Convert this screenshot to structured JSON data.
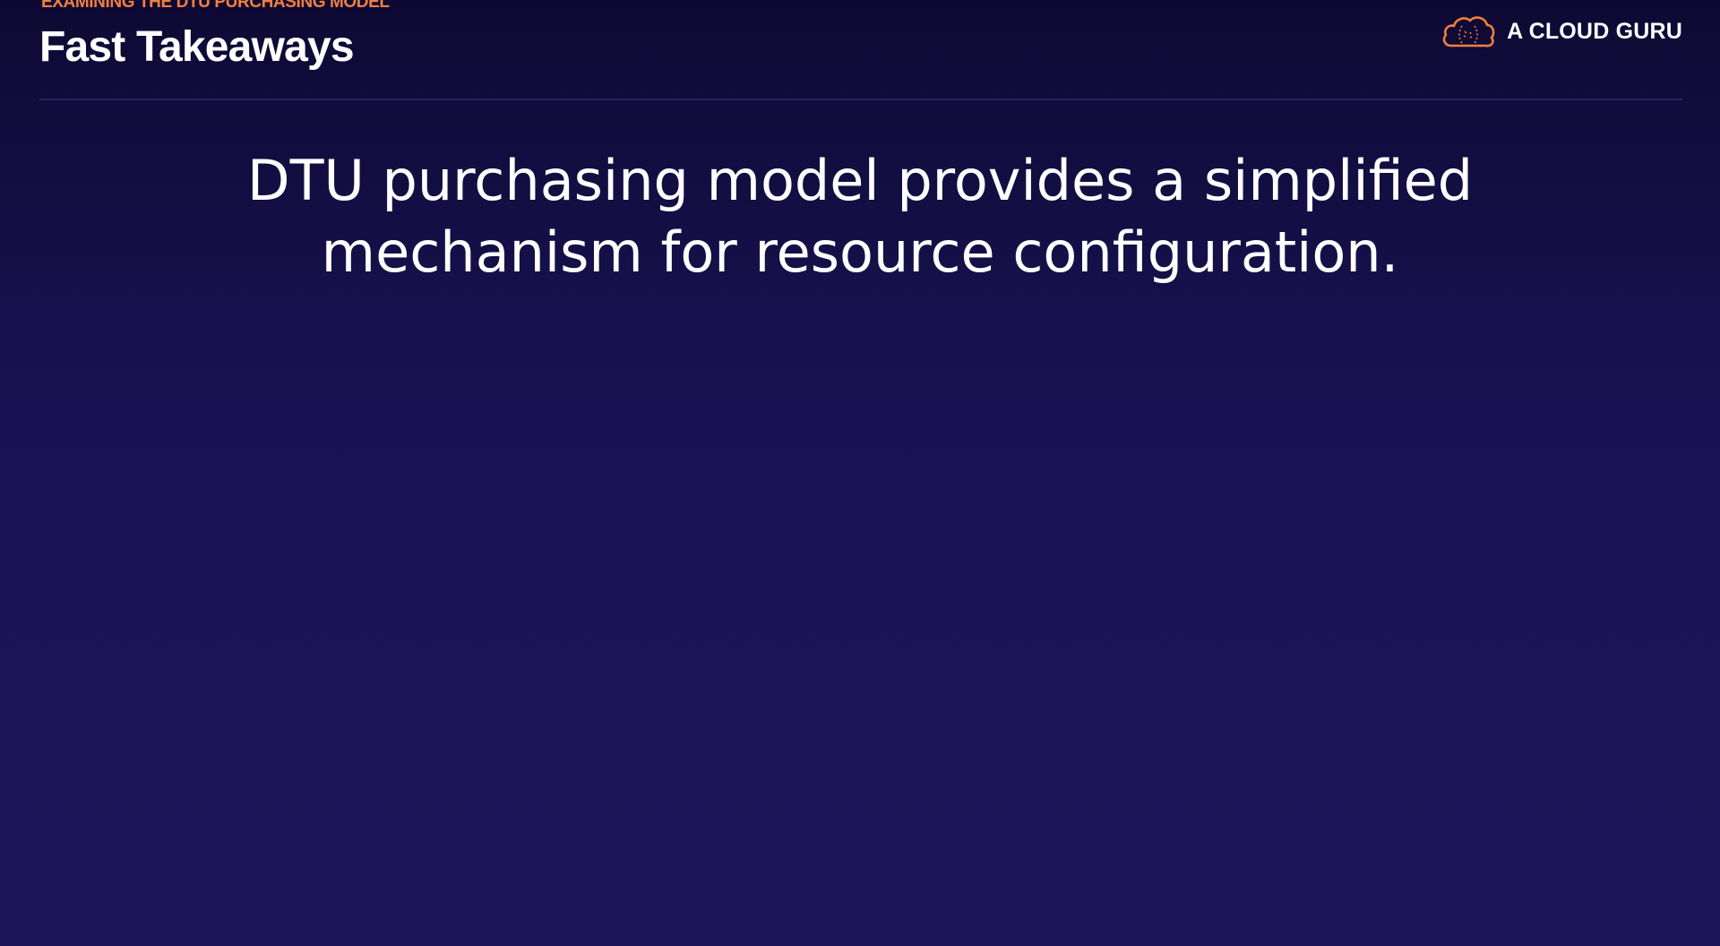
{
  "header": {
    "eyebrow": "EXAMINING THE DTU PURCHASING MODEL",
    "title": "Fast Takeaways"
  },
  "brand": {
    "name": "A CLOUD GURU",
    "logo_icon": "cloud-logo-icon"
  },
  "content": {
    "takeaway": "DTU purchasing model provides a simplified mechanism for resource configuration."
  },
  "colors": {
    "accent": "#f0803c",
    "background_top": "#0e0933",
    "background_bottom": "#1c1458",
    "text": "#ffffff"
  }
}
